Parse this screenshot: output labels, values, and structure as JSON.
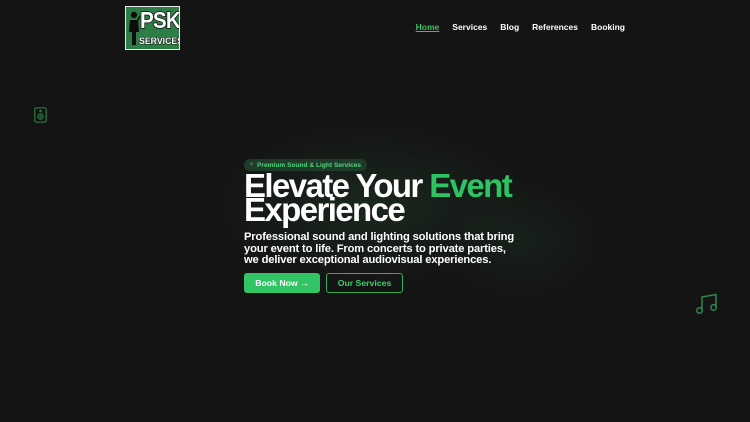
{
  "logo": {
    "line1": "PSK",
    "line2": "SERVICES"
  },
  "nav": {
    "items": [
      {
        "label": "Home",
        "active": true
      },
      {
        "label": "Services",
        "active": false
      },
      {
        "label": "Blog",
        "active": false
      },
      {
        "label": "References",
        "active": false
      },
      {
        "label": "Booking",
        "active": false
      }
    ]
  },
  "hero": {
    "badge": {
      "icon": "sparkle-icon",
      "label": "Premium Sound & Light Services"
    },
    "headline": {
      "line1_start": "Elevate Your ",
      "line1_accent": "Event",
      "line2": "Experience"
    },
    "description": "Professional sound and lighting solutions that bring your event to life. From concerts to private parties, we deliver exceptional audiovisual experiences.",
    "primary_button": "Book Now →",
    "secondary_button": "Our Services"
  },
  "decorations": {
    "left_icon": "speaker-icon",
    "right_icon": "music-note-icon"
  },
  "colors": {
    "background": "#141414",
    "accent": "#2fc463",
    "logo_green": "#2d7d46",
    "badge_bg": "#1f3b29"
  }
}
